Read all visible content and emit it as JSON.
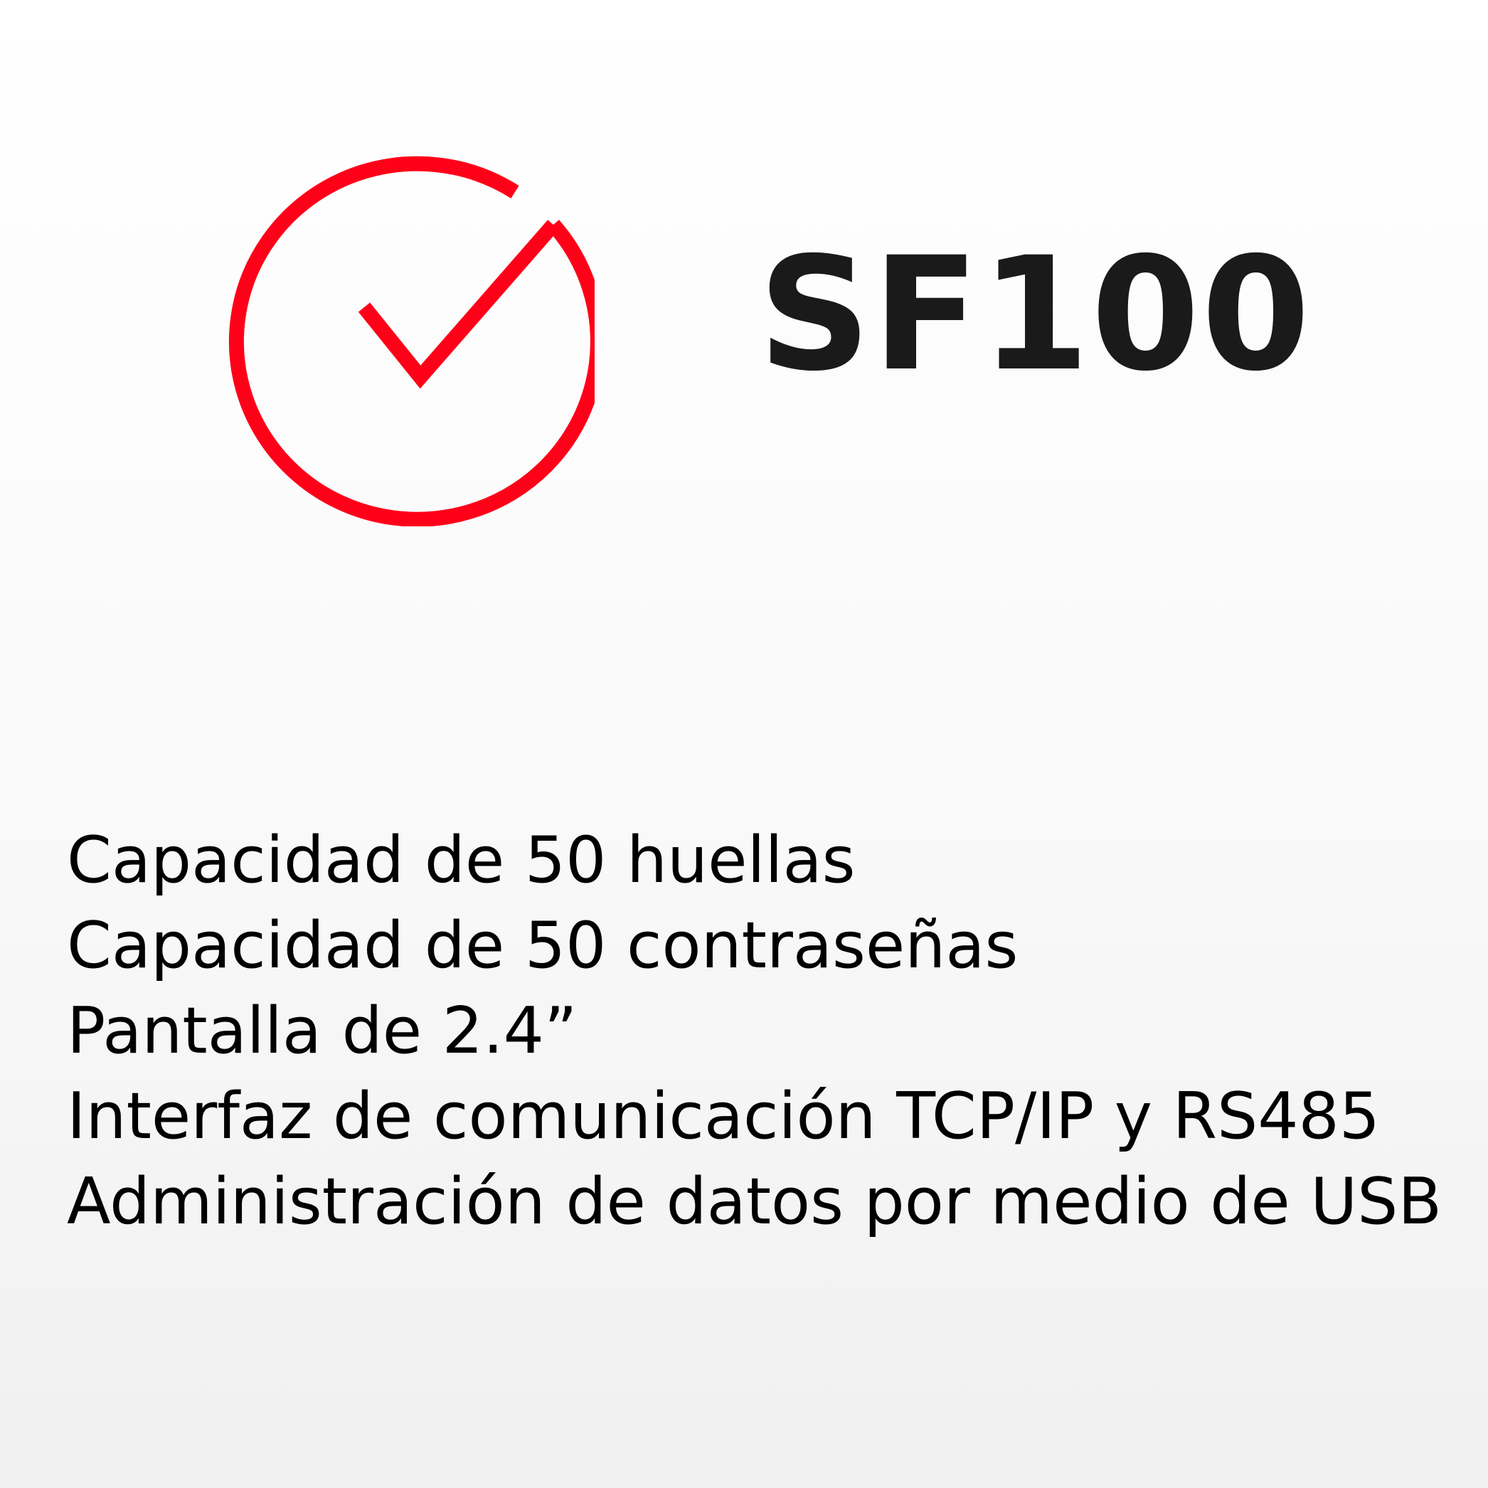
{
  "colors": {
    "accent": "#ff0019",
    "title": "#1a1a1a",
    "text": "#000000"
  },
  "icon": "circle-checkmark-icon",
  "title": "SF100",
  "features": [
    "Capacidad de 50 huellas",
    "Capacidad de 50 contraseñas",
    "Pantalla de 2.4”",
    "Interfaz de comunicación TCP/IP y RS485",
    "Administración de datos por medio de USB"
  ]
}
